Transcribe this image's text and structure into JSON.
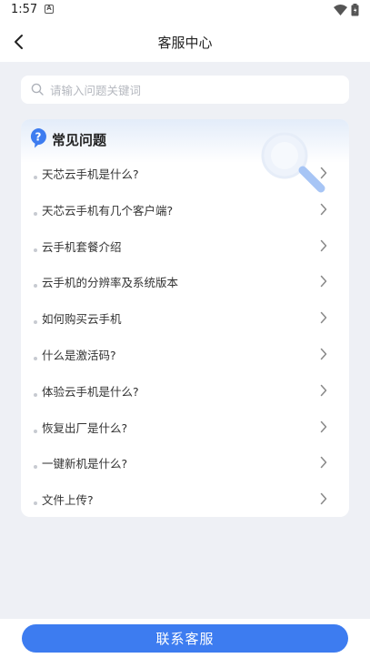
{
  "status_bar": {
    "time": "1:57",
    "notification_icon": "a-box-icon",
    "wifi_icon": "wifi-icon",
    "battery_icon": "battery-icon"
  },
  "header": {
    "title": "客服中心",
    "back_icon": "chevron-left-icon"
  },
  "search": {
    "placeholder": "请输入问题关键词",
    "value": ""
  },
  "faq": {
    "title": "常见问题",
    "items": [
      "天芯云手机是什么?",
      "天芯云手机有几个客户端?",
      "云手机套餐介绍",
      "云手机的分辨率及系统版本",
      "如何购买云手机",
      "什么是激活码?",
      "体验云手机是什么?",
      "恢复出厂是什么?",
      "一键新机是什么?",
      "文件上传?"
    ]
  },
  "footer": {
    "contact_label": "联系客服"
  },
  "colors": {
    "accent": "#3d7cf0",
    "background": "#eef0f5",
    "card": "#ffffff"
  }
}
